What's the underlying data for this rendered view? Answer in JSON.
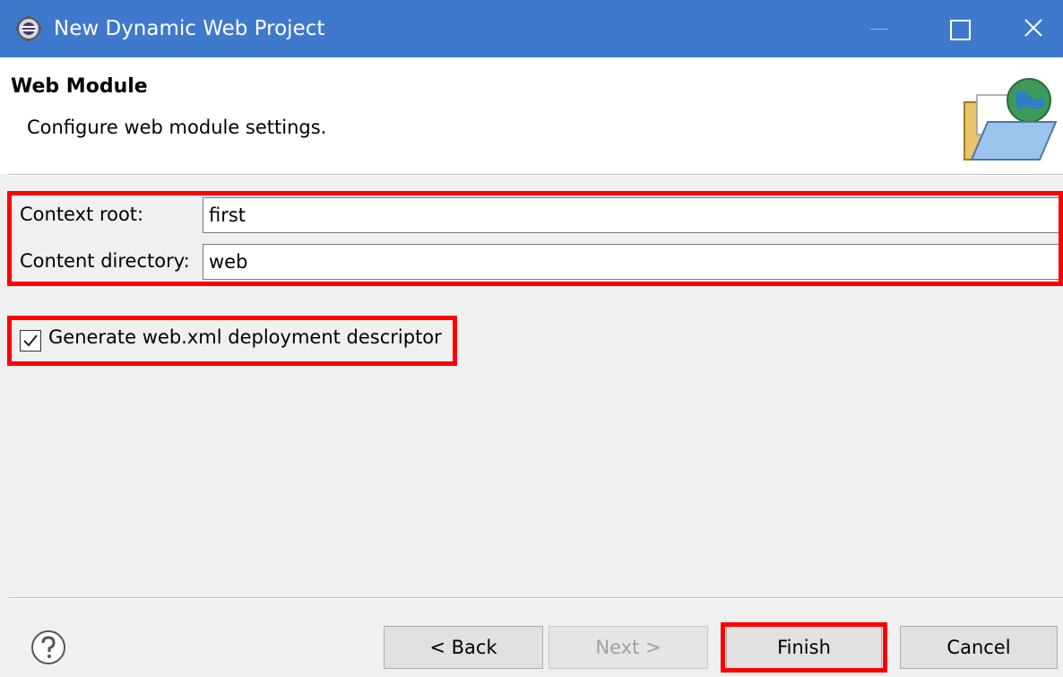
{
  "window": {
    "title": "New Dynamic Web Project",
    "icon": "eclipse-gear-icon"
  },
  "header": {
    "title": "Web Module",
    "description": "Configure web module settings.",
    "icon": "web-folder-globe-icon"
  },
  "form": {
    "context_root": {
      "label": "Context root:",
      "value": "first"
    },
    "content_directory": {
      "label": "Content directory:",
      "value": "web"
    },
    "generate_descriptor": {
      "label": "Generate web.xml deployment descriptor",
      "checked": true
    }
  },
  "footer": {
    "help_icon": "question-mark-icon",
    "back_label": "< Back",
    "next_label": "Next >",
    "finish_label": "Finish",
    "cancel_label": "Cancel"
  },
  "colors": {
    "titlebar": "#3f79cc",
    "highlight": "#ff0000",
    "dialog_bg": "#f0f0f0",
    "header_bg": "#ffffff"
  }
}
